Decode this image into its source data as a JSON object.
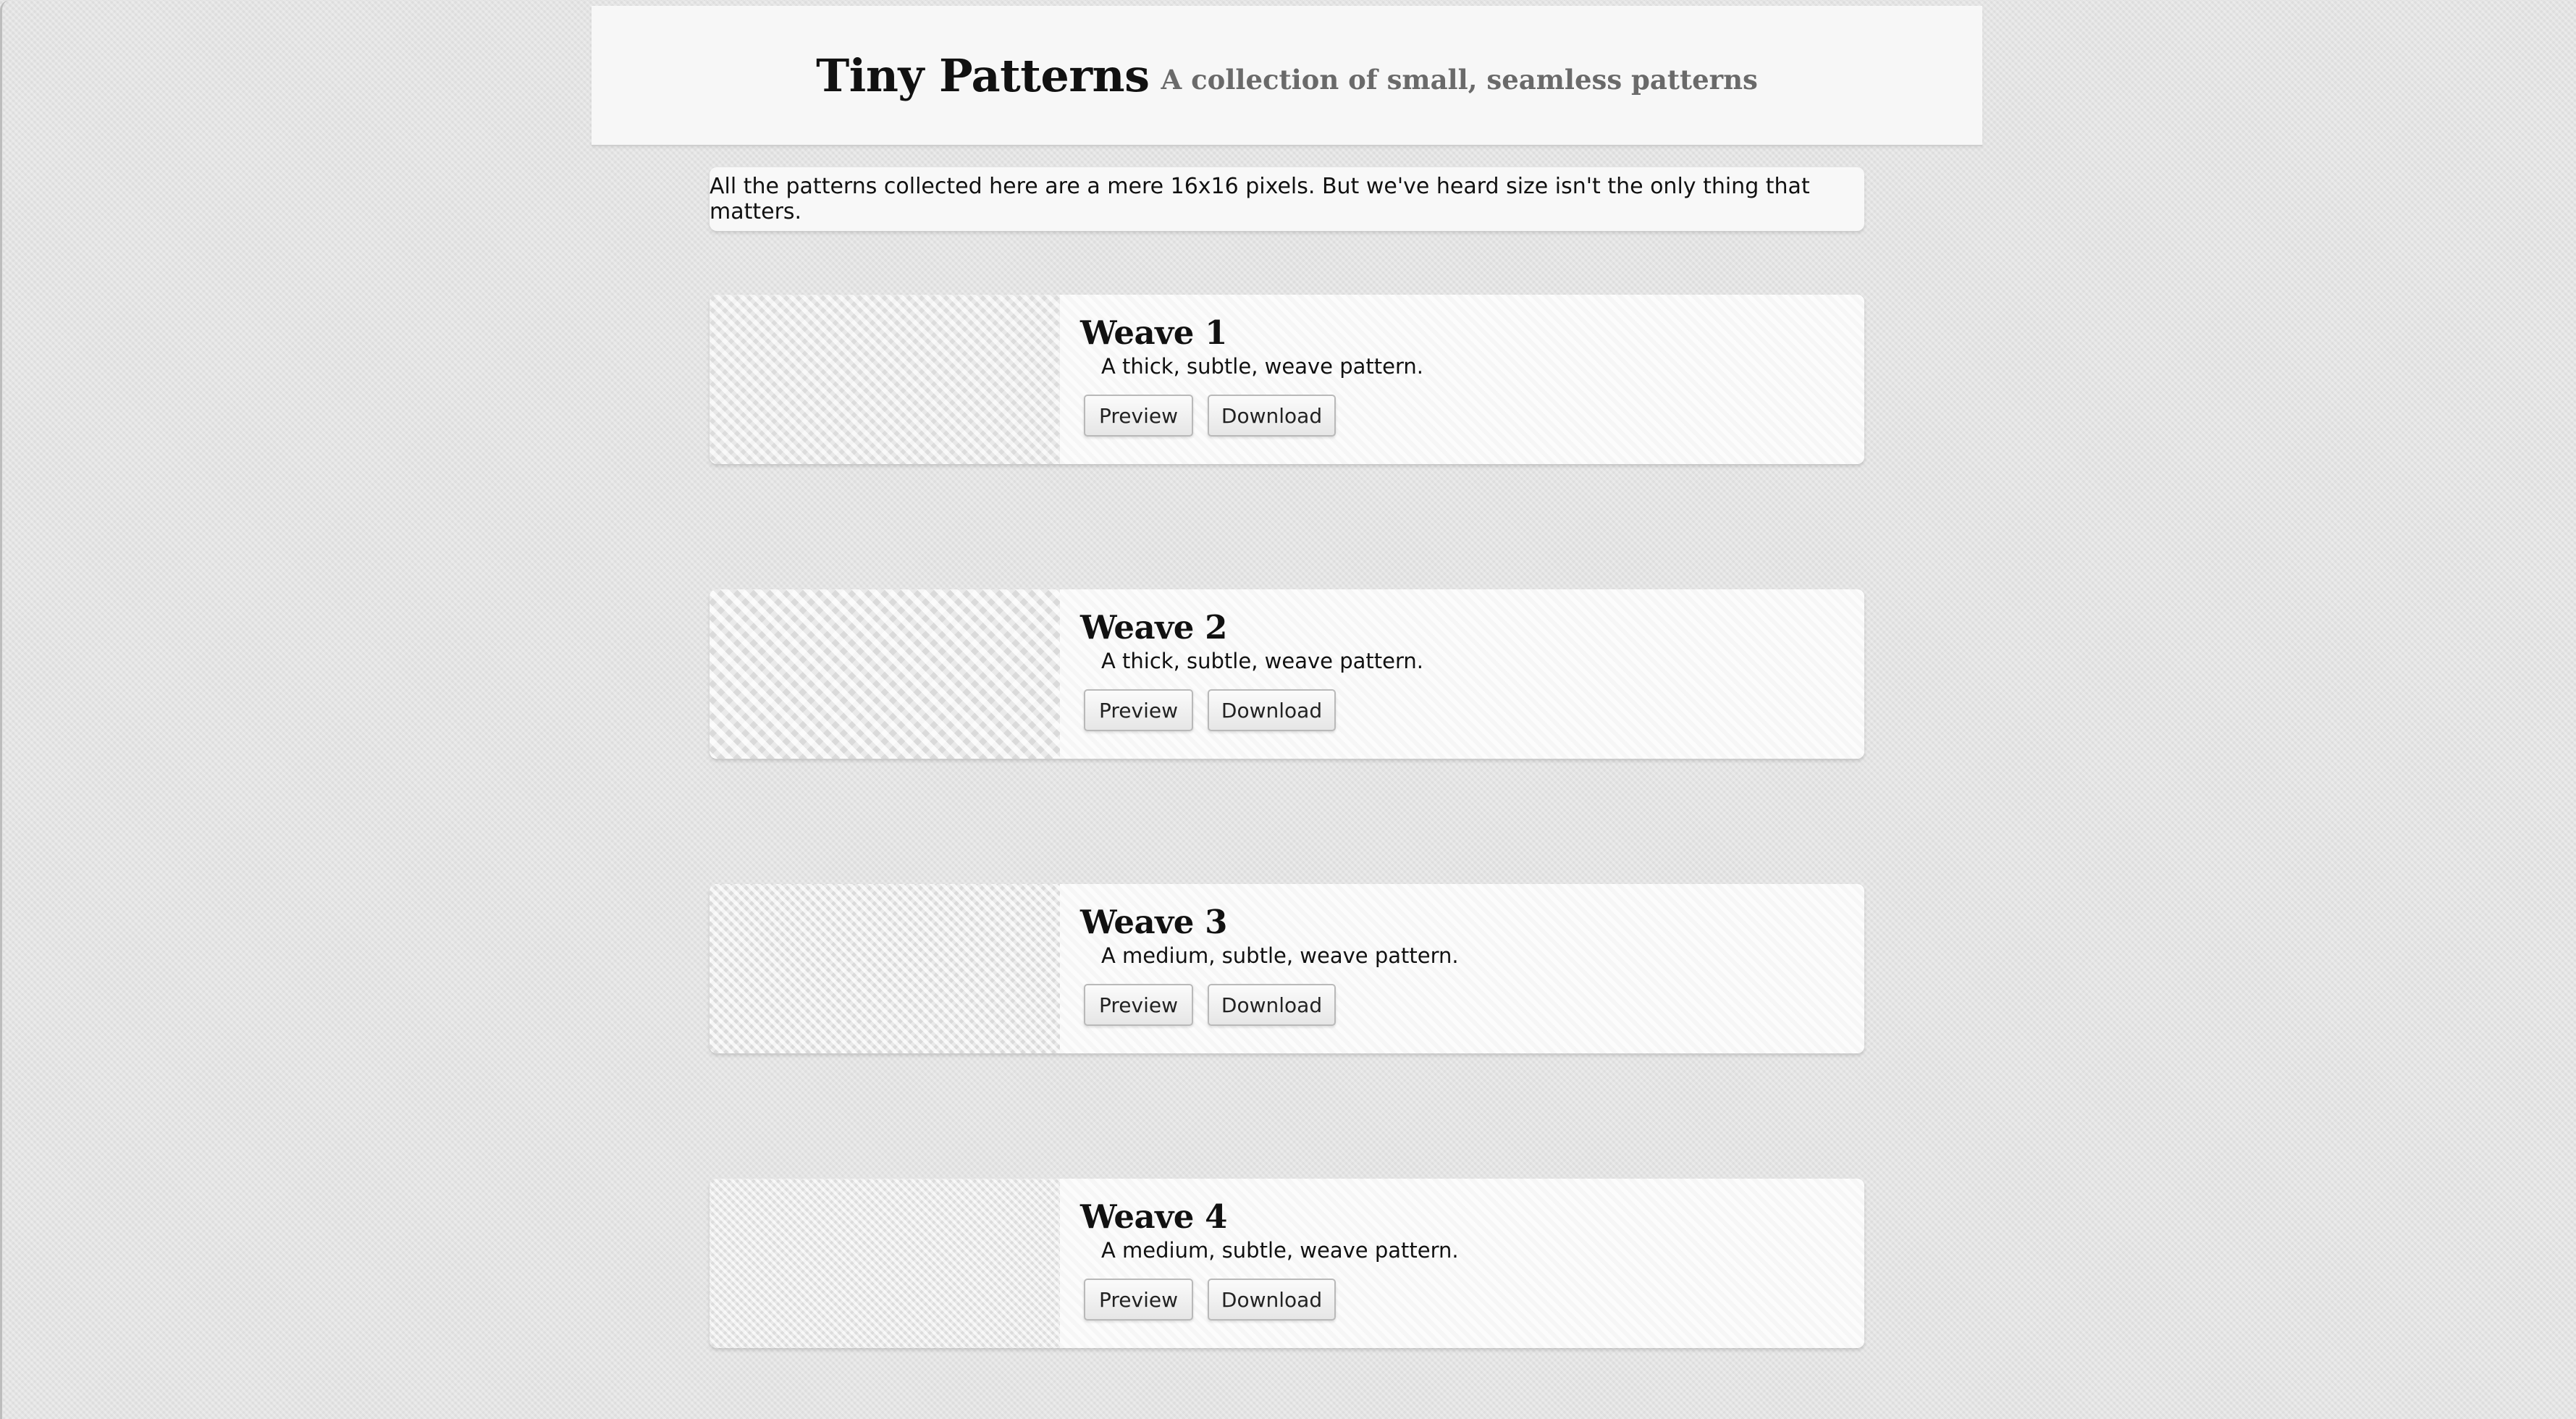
{
  "header": {
    "title": "Tiny Patterns",
    "subtitle": "A collection of small, seamless patterns"
  },
  "intro": {
    "text": "All the patterns collected here are a mere 16x16 pixels. But we've heard size isn't the only thing that matters."
  },
  "patterns": [
    {
      "name": "Weave 1",
      "description": "A thick, subtle, weave pattern.",
      "preview_label": "Preview",
      "download_label": "Download"
    },
    {
      "name": "Weave 2",
      "description": "A thick, subtle, weave pattern.",
      "preview_label": "Preview",
      "download_label": "Download"
    },
    {
      "name": "Weave 3",
      "description": "A medium, subtle, weave pattern.",
      "preview_label": "Preview",
      "download_label": "Download"
    },
    {
      "name": "Weave 4",
      "description": "A medium, subtle, weave pattern.",
      "preview_label": "Preview",
      "download_label": "Download"
    }
  ]
}
